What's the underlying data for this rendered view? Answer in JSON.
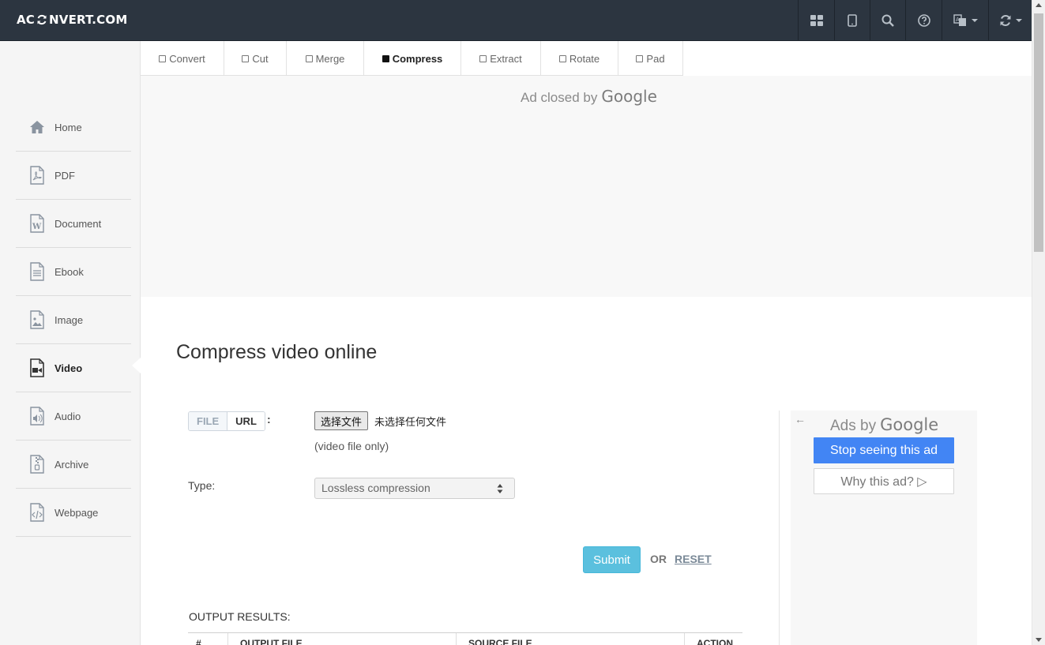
{
  "brand": {
    "logo_left": "AC",
    "logo_right": "NVERT.COM"
  },
  "topnav": {
    "icons": [
      "grid-icon",
      "tablet-icon",
      "search-icon",
      "help-icon",
      "language-icon",
      "refresh-icon"
    ]
  },
  "sidebar": {
    "items": [
      {
        "label": "Home",
        "icon": "home-icon"
      },
      {
        "label": "PDF",
        "icon": "pdf-file-icon"
      },
      {
        "label": "Document",
        "icon": "word-file-icon"
      },
      {
        "label": "Ebook",
        "icon": "ebook-file-icon"
      },
      {
        "label": "Image",
        "icon": "image-file-icon"
      },
      {
        "label": "Video",
        "icon": "video-file-icon",
        "active": true
      },
      {
        "label": "Audio",
        "icon": "audio-file-icon"
      },
      {
        "label": "Archive",
        "icon": "archive-file-icon"
      },
      {
        "label": "Webpage",
        "icon": "code-file-icon"
      }
    ]
  },
  "tabs": [
    {
      "label": "Convert"
    },
    {
      "label": "Cut"
    },
    {
      "label": "Merge"
    },
    {
      "label": "Compress",
      "active": true
    },
    {
      "label": "Extract"
    },
    {
      "label": "Rotate"
    },
    {
      "label": "Pad"
    }
  ],
  "ad_top": {
    "closed_text": "Ad closed by",
    "google": "Google"
  },
  "page": {
    "title": "Compress video online"
  },
  "form": {
    "source_file": "FILE",
    "source_url": "URL",
    "colon": ":",
    "choose_button": "选择文件",
    "no_file": "未选择任何文件",
    "hint": "(video file only)",
    "type_label": "Type:",
    "type_value": "Lossless compression",
    "submit": "Submit",
    "or": "OR",
    "reset": "RESET"
  },
  "results": {
    "title": "OUTPUT RESULTS:",
    "columns": [
      "#",
      "OUTPUT FILE",
      "SOURCE FILE",
      "ACTION"
    ]
  },
  "side_ad": {
    "back": "←",
    "ads_by": "Ads by",
    "google": "Google",
    "stop": "Stop seeing this ad",
    "why": "Why this ad? ▷"
  },
  "colors": {
    "topbar": "#2c3540",
    "submit": "#5bc0de",
    "google_blue": "#4285f4"
  }
}
